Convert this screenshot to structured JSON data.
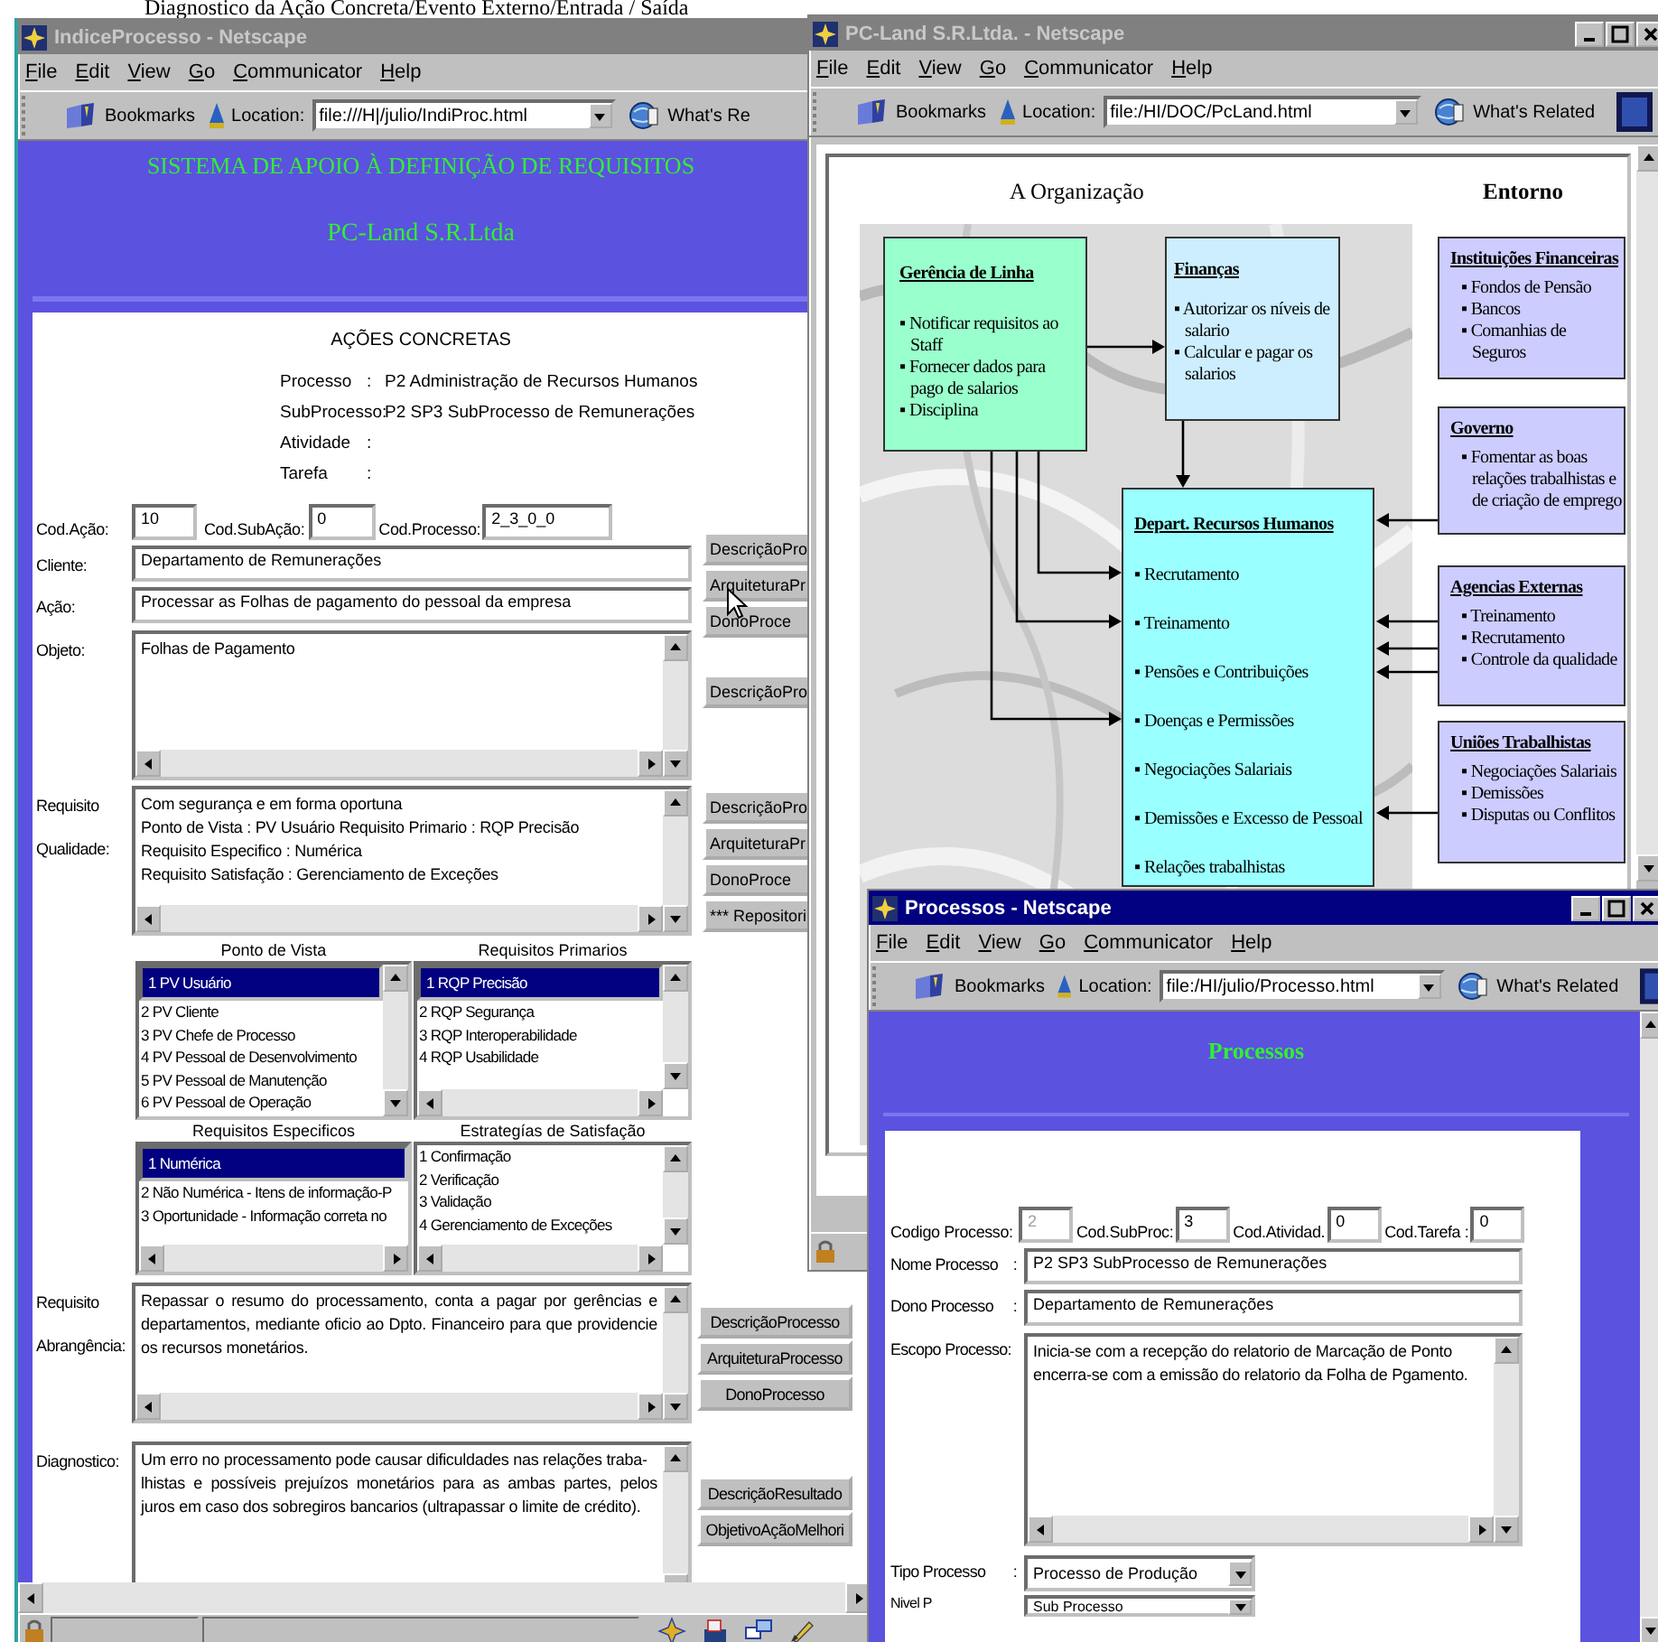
{
  "heading": "Diagnostico da Ação Concreta/Evento Externo/Entrada / Saída",
  "indice_window": {
    "title": "IndiceProcesso - Netscape",
    "active": false,
    "menu": [
      "File",
      "Edit",
      "View",
      "Go",
      "Communicator",
      "Help"
    ],
    "toolbar": {
      "bookmarks": "Bookmarks",
      "location_label": "Location:",
      "location": "file:///H|/julio/IndiProc.html",
      "related": "What's Re"
    },
    "banner": {
      "title": "SISTEMA DE APOIO À DEFINIÇÃO DE REQUISITOS",
      "subtitle": "PC-Land S.R.Ltda"
    },
    "form": {
      "heading": "AÇÕES CONCRETAS",
      "info": [
        {
          "label": "Processo",
          "colon": ":",
          "value": "P2 Administração de Recursos Humanos"
        },
        {
          "label": "SubProcesso:",
          "value": "P2 SP3 SubProcesso de Remunerações"
        },
        {
          "label": "Atividade",
          "colon": ":"
        },
        {
          "label": "Tarefa",
          "colon": ":"
        }
      ],
      "codes": [
        {
          "label": "Cod.Ação:",
          "value": "10"
        },
        {
          "label": "Cod.SubAção:",
          "value": "0"
        },
        {
          "label": "Cod.Processo:",
          "value": "2_3_0_0"
        }
      ],
      "fields": [
        {
          "kind": "input",
          "label": [
            "Cliente:"
          ],
          "value": "Departamento de Remunerações"
        },
        {
          "kind": "input",
          "label": [
            "Ação:"
          ],
          "value": "Processar as Folhas de pagamento do pessoal da empresa"
        },
        {
          "kind": "textarea",
          "label": [
            "Objeto:"
          ],
          "lines": [
            "Folhas de Pagamento"
          ]
        },
        {
          "kind": "textarea",
          "label": [
            "Requisito",
            "Qualidade:"
          ],
          "lines": [
            "Com segurança e em forma oportuna",
            "Ponto de Vista : PV Usuário Requisito Primario : RQP Precisão",
            "Requisito Especifico : Numérica",
            "Requisito Satisfação : Gerenciamento de Exceções"
          ]
        }
      ],
      "button_groups": [
        [
          "DescriçãoPro",
          "ArquiteturaPr",
          "DonoProce"
        ],
        [
          "DescriçãoPro"
        ],
        [
          "DescriçãoPro",
          "ArquiteturaPr",
          "DonoProce",
          "*** Repositori"
        ]
      ],
      "lists": [
        {
          "title": "Ponto de Vista",
          "vertical_scroll": true,
          "horizontal_scroll": false,
          "items": [
            {
              "text": "1 PV Usuário",
              "selected": true
            },
            {
              "text": "2 PV Cliente",
              "selected": false
            },
            {
              "text": "3 PV Chefe de Processo",
              "selected": false
            },
            {
              "text": "4 PV Pessoal de Desenvolvimento",
              "selected": false
            },
            {
              "text": "5 PV Pessoal de Manutenção",
              "selected": false
            },
            {
              "text": "6 PV Pessoal de Operação",
              "selected": false
            }
          ]
        },
        {
          "title": "Requisitos Primarios",
          "vertical_scroll": true,
          "horizontal_scroll": true,
          "items": [
            {
              "text": "1 RQP Precisão",
              "selected": true
            },
            {
              "text": "2 RQP Segurança",
              "selected": false
            },
            {
              "text": "3 RQP Interoperabilidade",
              "selected": false
            },
            {
              "text": "4 RQP Usabilidade",
              "selected": false
            }
          ]
        },
        {
          "title": "Requisitos Especificos",
          "vertical_scroll": false,
          "horizontal_scroll": true,
          "items": [
            {
              "text": "1 Numérica",
              "selected": true
            },
            {
              "text": "2 Não Numérica - Itens de informação-P",
              "selected": false
            },
            {
              "text": "3 Oportunidade - Informação correta no",
              "selected": false
            }
          ]
        },
        {
          "title": "Estrategías de Satisfação",
          "vertical_scroll": true,
          "horizontal_scroll": true,
          "items": [
            {
              "text": "1 Confirmação",
              "selected": false
            },
            {
              "text": "2 Verificação",
              "selected": false
            },
            {
              "text": "3 Validação",
              "selected": false
            },
            {
              "text": "4 Gerenciamento de Exceções",
              "selected": false
            }
          ]
        }
      ],
      "lower": [
        {
          "label": [
            "Requisito",
            "Abrangência:"
          ],
          "lines": [
            "Repassar o resumo do processamento, conta a pagar por gerências e departamentos, mediante oficio ao Dpto. Financeiro para que providencie os recursos monetários."
          ],
          "buttons": [
            "DescriçãoProcesso",
            "ArquiteturaProcesso",
            "DonoProcesso"
          ]
        },
        {
          "label": [
            "Diagnostico:"
          ],
          "lines": [
            "Um erro no processamento pode causar dificuldades nas relações traba-",
            "lhistas e possíveis prejuízos monetários para  as ambas partes, pelos juros em caso dos sobregiros bancarios (ultrapassar o limite de crédito)."
          ],
          "buttons": [
            "DescriçãoResultado",
            "ObjetivoAçãoMelhori"
          ]
        }
      ]
    }
  },
  "pcland_window": {
    "title": "PC-Land S.R.Ltda. - Netscape",
    "active": false,
    "controls": true,
    "menu": [
      "File",
      "Edit",
      "View",
      "Go",
      "Communicator",
      "Help"
    ],
    "toolbar": {
      "bookmarks": "Bookmarks",
      "location_label": "Location:",
      "location": "file:/HI/DOC/PcLand.html",
      "related": "What's Related"
    },
    "diagram": {
      "org_title": "A Organização",
      "env_title": "Entorno",
      "units": [
        {
          "title": "Gerência de Linha",
          "color": "#99ffcc",
          "items": [
            "▪ Notificar requisitos ao Staff",
            "▪ Fornecer dados para pago de salarios",
            "▪ Disciplina"
          ]
        },
        {
          "title": "Finanças",
          "color": "#cceeff",
          "items": [
            "▪ Autorizar os níveis de salario",
            "▪ Calcular e pagar os salarios"
          ]
        },
        {
          "title": "Depart. Recursos Humanos",
          "color": "#99ffff",
          "items": [
            "▪ Recrutamento",
            "▪ Treinamento",
            "▪ Pensões e Contribuições",
            "▪ Doenças e Permissões",
            "▪ Negociações Salariais",
            "▪ Demissões e Excesso de Pessoal",
            "▪ Relações trabalhistas"
          ]
        }
      ],
      "environment": [
        {
          "title": "Instituições Financeiras",
          "items": [
            "▪ Fondos de Pensão",
            "▪ Bancos",
            "▪ Comanhias de Seguros"
          ]
        },
        {
          "title": "Governo",
          "items": [
            "▪ Fomentar as boas relações trabalhistas e de criação de emprego"
          ]
        },
        {
          "title": "Agencias Externas",
          "items": [
            "▪ Treinamento",
            "▪ Recrutamento",
            "▪ Controle da qualidade"
          ]
        },
        {
          "title": "Uniões Trabalhistas",
          "items": [
            "▪ Negociações Salariais",
            "▪ Demissões",
            "▪ Disputas ou Conflitos"
          ]
        }
      ]
    }
  },
  "processos_window": {
    "title": "Processos - Netscape",
    "active": true,
    "controls": true,
    "menu": [
      "File",
      "Edit",
      "View",
      "Go",
      "Communicator",
      "Help"
    ],
    "toolbar": {
      "bookmarks": "Bookmarks",
      "location_label": "Location:",
      "location": "file:/HI/julio/Processo.html",
      "related": "What's Related"
    },
    "banner": "Processos",
    "codes": [
      {
        "label": "Codigo Processo:",
        "value": "2",
        "disabled": true
      },
      {
        "label": "Cod.SubProc:",
        "value": "3",
        "disabled": false
      },
      {
        "label": "Cod.Atividad.",
        "value": "0",
        "disabled": false
      },
      {
        "label": "Cod.Tarefa :",
        "value": "0",
        "disabled": false
      }
    ],
    "fields": [
      {
        "kind": "input",
        "label": "Nome Processo",
        "colon": ":",
        "value": "P2 SP3 SubProcesso de Remunerações"
      },
      {
        "kind": "input",
        "label": "Dono Processo",
        "colon": ":",
        "value": "Departamento de Remunerações"
      },
      {
        "kind": "textarea",
        "label": "Escopo Processo:",
        "lines": [
          "Inicia-se com a recepção do relatorio de Marcação de Ponto  encerra-se com a emissão do relatorio da Folha de Pgamento."
        ]
      },
      {
        "kind": "select",
        "label": "Tipo Processo",
        "colon": ":",
        "value": "Processo de Produção"
      },
      {
        "kind": "select",
        "label": "Nivel P",
        "value": "Sub Processo"
      }
    ]
  }
}
